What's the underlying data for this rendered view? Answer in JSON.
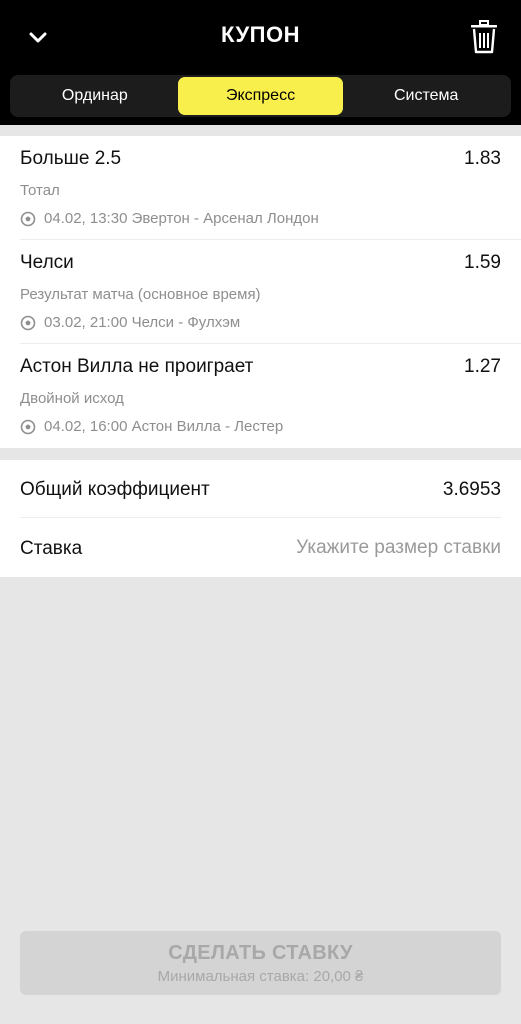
{
  "header": {
    "title": "КУПОН",
    "back_icon": "chevron-down-icon",
    "trash_icon": "trash-icon"
  },
  "tabs": [
    {
      "label": "Ординар",
      "active": false
    },
    {
      "label": "Экспресс",
      "active": true
    },
    {
      "label": "Система",
      "active": false
    }
  ],
  "bets": [
    {
      "name": "Больше  2.5",
      "odd": "1.83",
      "market": "Тотал",
      "event": "04.02, 13:30 Эвертон - Арсенал Лондон"
    },
    {
      "name": "Челси",
      "odd": "1.59",
      "market": "Результат матча (основное время)",
      "event": "03.02, 21:00 Челси - Фулхэм"
    },
    {
      "name": "Астон Вилла не проиграет",
      "odd": "1.27",
      "market": "Двойной исход",
      "event": "04.02, 16:00 Астон Вилла - Лестер"
    }
  ],
  "summary": {
    "total_label": "Общий коэффициент",
    "total_value": "3.6953",
    "stake_label": "Ставка",
    "stake_placeholder": "Укажите размер ставки"
  },
  "submit": {
    "label": "СДЕЛАТЬ СТАВКУ",
    "min_stake": "Минимальная ставка: 20,00 ₴"
  },
  "colors": {
    "accent": "#f9ef4c",
    "header_bg": "#000000",
    "page_bg": "#e6e6e6"
  }
}
